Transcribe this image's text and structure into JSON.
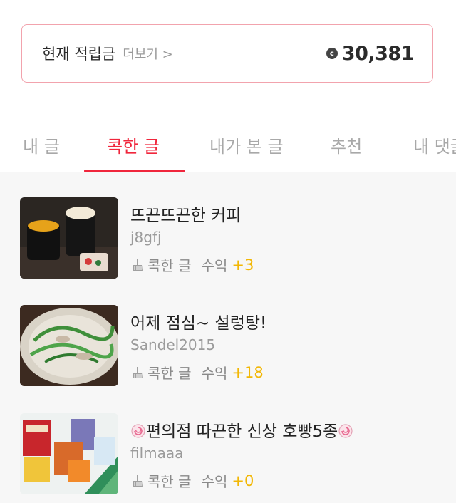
{
  "points": {
    "title": "현재 적립금",
    "more": "더보기 >",
    "coin_icon": "coin-icon",
    "value": "30,381"
  },
  "tabs": [
    {
      "label": "내 글",
      "active": false
    },
    {
      "label": "콕한 글",
      "active": true
    },
    {
      "label": "내가 본 글",
      "active": false
    },
    {
      "label": "추천",
      "active": false
    },
    {
      "label": "내 댓글",
      "active": false
    }
  ],
  "posts": [
    {
      "title": "뜨끈뜨끈한 커피",
      "author": "j8gfj",
      "meta_label": "콕한 글",
      "earn_label": "수익",
      "earn_value": "+3"
    },
    {
      "title": "어제 점심~ 설렁탕!",
      "author": "Sandel2015",
      "meta_label": "콕한 글",
      "earn_label": "수익",
      "earn_value": "+18"
    },
    {
      "title": "편의점 따끈한 신상 호빵5종",
      "author": "filmaaa",
      "meta_label": "콕한 글",
      "earn_label": "수익",
      "earn_value": "+0"
    }
  ],
  "colors": {
    "accent": "#f0263c",
    "earn": "#f2b705",
    "card_border": "#f2a3ad"
  }
}
